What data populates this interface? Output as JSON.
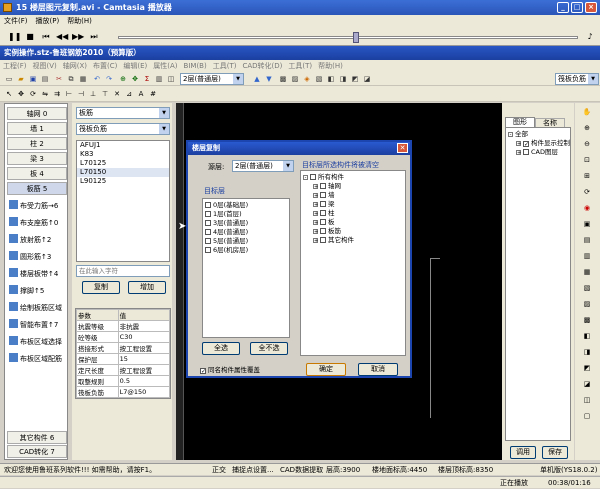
{
  "player": {
    "title": "15 楼层图元复制.avi - Camtasia 播放器",
    "menu": [
      "文件(F)",
      "播放(P)",
      "帮助(H)"
    ],
    "status": "正在播放",
    "time": "00:38/01:16"
  },
  "app": {
    "title": "实例操作.stz-鲁班钢筋2010（预算版）",
    "menu": [
      "工程(F)",
      "视图(V)",
      "轴网(X)",
      "布置(C)",
      "编辑(E)",
      "属性(A)",
      "BIM(B)",
      "工具(T)",
      "CAD转化(D)",
      "工具(T)",
      "帮助(H)"
    ],
    "floor_select": "2层(普通层)",
    "element_select": "筏板负筋"
  },
  "left_panel": {
    "categories": [
      {
        "label": "轴网",
        "count": "0"
      },
      {
        "label": "墙",
        "count": "1"
      },
      {
        "label": "柱",
        "count": "2"
      },
      {
        "label": "梁",
        "count": "3"
      },
      {
        "label": "板",
        "count": "4"
      },
      {
        "label": "板筋",
        "count": "5"
      }
    ],
    "tools": [
      {
        "label": "布受力筋",
        "suffix": "→6"
      },
      {
        "label": "布支座筋",
        "suffix": "↑0"
      },
      {
        "label": "放射筋",
        "suffix": "↑2"
      },
      {
        "label": "圆形筋",
        "suffix": "↑3"
      },
      {
        "label": "楼层板带",
        "suffix": "↑4"
      },
      {
        "label": "撑脚",
        "suffix": "↑5"
      },
      {
        "label": "绘制板筋区域",
        "suffix": ""
      },
      {
        "label": "智能布置",
        "suffix": "↑7"
      },
      {
        "label": "布板区域选择",
        "suffix": ""
      },
      {
        "label": "布板区域配筋",
        "suffix": ""
      }
    ],
    "bottom": [
      {
        "label": "其它构件",
        "count": "6"
      },
      {
        "label": "CAD转化",
        "count": "7"
      }
    ]
  },
  "mid_panel": {
    "select_top": "板筋",
    "select_second": "筏板负筋",
    "list": [
      "AFUJ1",
      "K83",
      "L70125",
      "L70150",
      "L90125"
    ],
    "selected_index": 3,
    "input_placeholder": "在此输入字符",
    "copy_button": "复制",
    "add_button": "增加",
    "props_header": [
      "参数",
      "值"
    ],
    "props": [
      [
        "抗震等级",
        "非抗震"
      ],
      [
        "砼等级",
        "C30"
      ],
      [
        "搭接形式",
        "按工程设置"
      ],
      [
        "保护层",
        "15"
      ],
      [
        "定尺长度",
        "按工程设置"
      ],
      [
        "取整规则",
        "0.5"
      ],
      [
        "筏板负筋",
        "L7@150"
      ]
    ]
  },
  "dialog": {
    "title": "楼层复制",
    "source_label": "源层:",
    "source_value": "2层(普通层)",
    "target_label": "目标层",
    "target_floors": [
      "0层(基础层)",
      "1层(首层)",
      "3层(普通层)",
      "4层(普通层)",
      "5层(普通层)",
      "6层(机房层)"
    ],
    "select_all": "全选",
    "select_none": "全不选",
    "right_label": "目标层所选构件将被清空",
    "tree_root": "所有构件",
    "tree_items": [
      "轴网",
      "墙",
      "梁",
      "柱",
      "板",
      "板筋",
      "其它构件"
    ],
    "overwrite_label": "同名构件属性覆盖",
    "ok": "确定",
    "cancel": "取消"
  },
  "right_panel": {
    "tabs": [
      "图形",
      "名称"
    ],
    "tree_root": "全部",
    "tree_items": [
      "构件显示控制",
      "CAD图层"
    ],
    "apply": "调用",
    "save": "保存"
  },
  "status": {
    "welcome": "欢迎您使用鲁班系列软件!!!  如需帮助，请按F1。",
    "mode": "正交",
    "snap": "捕捉点设置...",
    "cad": "CAD数据提取",
    "floor_elev": "层高:3900",
    "bottom_elev": "楼地面标高:4450",
    "top_elev": "楼层顶标高:8350",
    "version": "单机版(YS18.0.2)"
  }
}
